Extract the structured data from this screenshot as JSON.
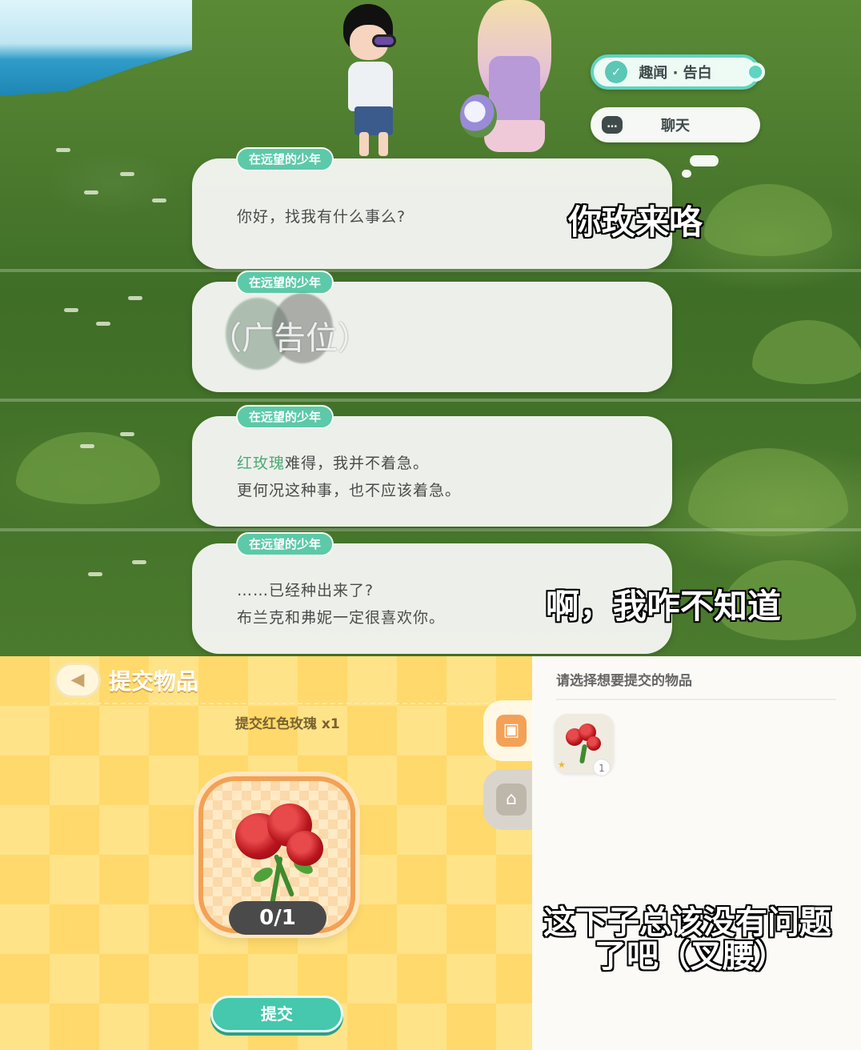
{
  "menu": {
    "topic_label": "趣闻 · 告白",
    "chat_label": "聊天"
  },
  "dialogs": [
    {
      "speaker": "在远望的少年",
      "lines": [
        "你好，找我有什么事么?"
      ]
    },
    {
      "speaker": "在远望的少年",
      "lines": []
    },
    {
      "speaker": "在远望的少年",
      "lines": [
        "难得，我并不着急。",
        "更何况这种事，也不应该着急。"
      ],
      "highlight": "红玫瑰"
    },
    {
      "speaker": "在远望的少年",
      "lines": [
        "……已经种出来了?",
        "布兰克和弗妮一定很喜欢你。"
      ]
    }
  ],
  "ad_placeholder": "（广告位）",
  "captions": {
    "c1": "你玫来咯",
    "c2": "啊，我咋不知道",
    "c3_line1": "这下子总该没有问题",
    "c3_line2": "了吧（叉腰）"
  },
  "submit_panel": {
    "title": "提交物品",
    "requirement": "提交红色玫瑰 x1",
    "progress": "0/1",
    "submit_label": "提交"
  },
  "item_list": {
    "title": "请选择想要提交的物品",
    "items": [
      {
        "name": "红色玫瑰",
        "count": "1"
      }
    ]
  },
  "colors": {
    "accent_teal": "#45c8ad",
    "panel_yellow": "#ffd96b",
    "frame_orange": "#f3a156",
    "highlight_green": "#4fa97a"
  }
}
